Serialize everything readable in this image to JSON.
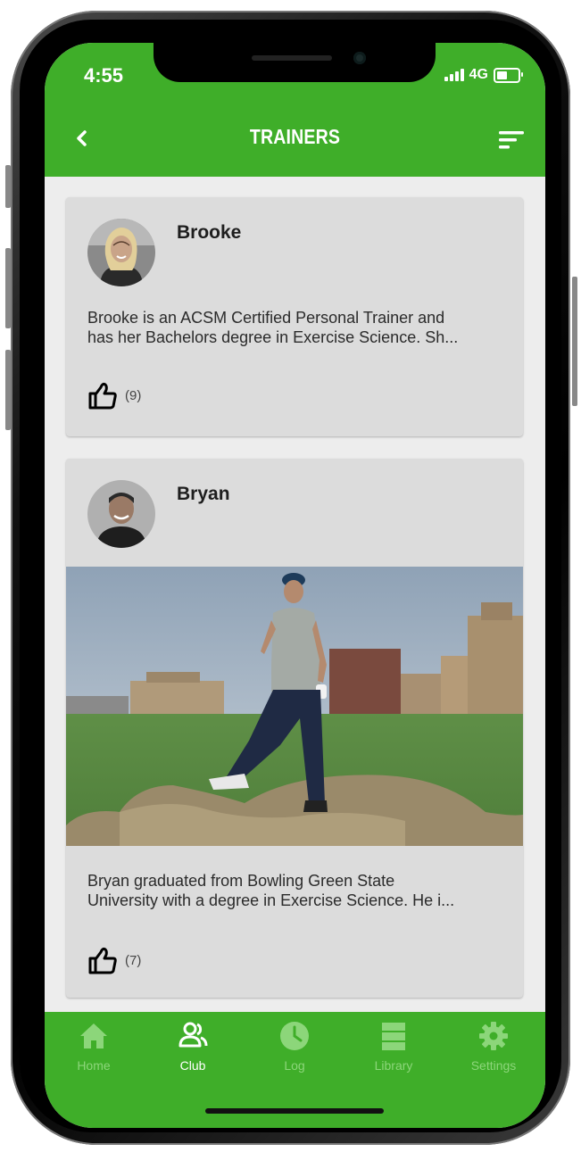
{
  "status_bar": {
    "time": "4:55",
    "network": "4G"
  },
  "header": {
    "title": "TRAINERS"
  },
  "trainers": [
    {
      "name": "Brooke",
      "bio": "Brooke is an ACSM Certified Personal Trainer and\nhas her Bachelors degree in Exercise Science.  Sh...",
      "likes": "(9)"
    },
    {
      "name": "Bryan",
      "bio": "Bryan graduated from Bowling Green State\nUniversity with a degree in Exercise Science.  He i...",
      "likes": "(7)"
    }
  ],
  "tabs": [
    {
      "label": "Home",
      "icon": "home-icon",
      "active": false
    },
    {
      "label": "Club",
      "icon": "club-icon",
      "active": true
    },
    {
      "label": "Log",
      "icon": "clock-icon",
      "active": false
    },
    {
      "label": "Library",
      "icon": "library-icon",
      "active": false
    },
    {
      "label": "Settings",
      "icon": "gear-icon",
      "active": false
    }
  ],
  "colors": {
    "brand_green": "#3fae29",
    "card_bg": "#dcdcdc",
    "screen_bg": "#ededed",
    "inactive_tab": "#8cd67a"
  }
}
